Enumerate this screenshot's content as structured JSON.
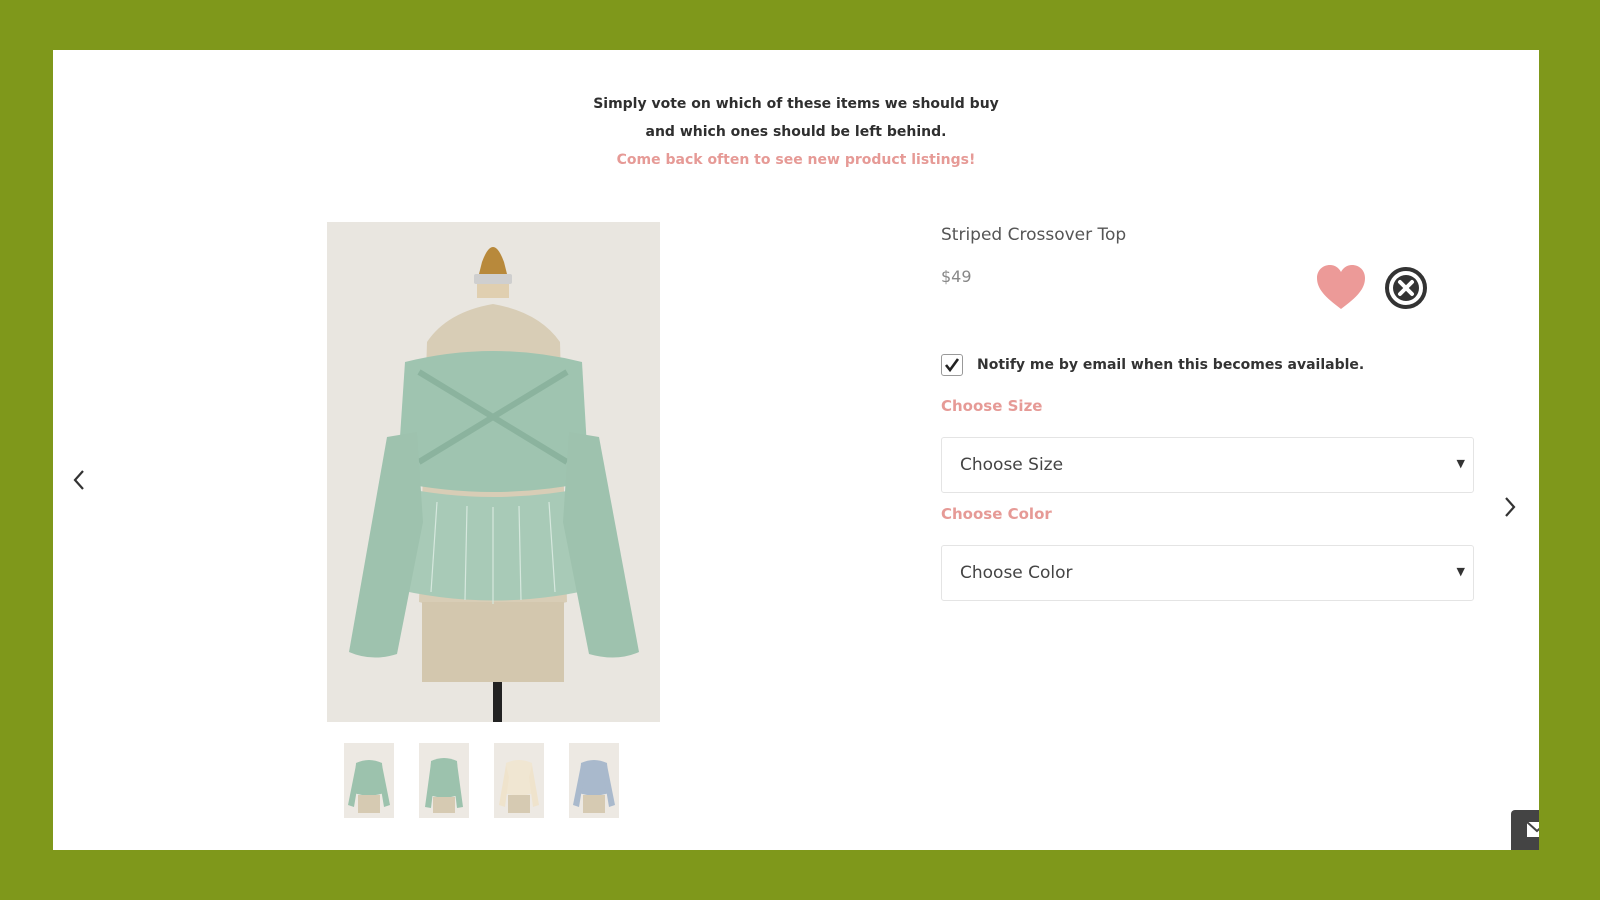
{
  "intro": {
    "line1": "Simply vote on which of these items we should buy",
    "line2": "and which ones should be left behind.",
    "promo": "Come back often to see new product listings!"
  },
  "product": {
    "title": "Striped Crossover Top",
    "price": "$49",
    "image_icon": "mannequin-blouse-image",
    "thumbnails": [
      {
        "icon": "thumbnail-sage-front",
        "color": "#9cc2ad"
      },
      {
        "icon": "thumbnail-sage-alt",
        "color": "#9cc2ad"
      },
      {
        "icon": "thumbnail-cream",
        "color": "#f0e6d2"
      },
      {
        "icon": "thumbnail-blue",
        "color": "#a9b9cc"
      }
    ]
  },
  "actions": {
    "like_icon": "heart-icon",
    "reject_icon": "close-circle-icon"
  },
  "notify": {
    "label": "Notify me by email when this becomes available.",
    "checked": true
  },
  "size": {
    "label": "Choose Size",
    "selected": "Choose Size"
  },
  "color": {
    "label": "Choose Color",
    "selected": "Choose Color"
  },
  "colors": {
    "background": "#7f981b",
    "accent": "#e69a96",
    "heart": "#ec9a98",
    "text": "#2f2f2f"
  }
}
